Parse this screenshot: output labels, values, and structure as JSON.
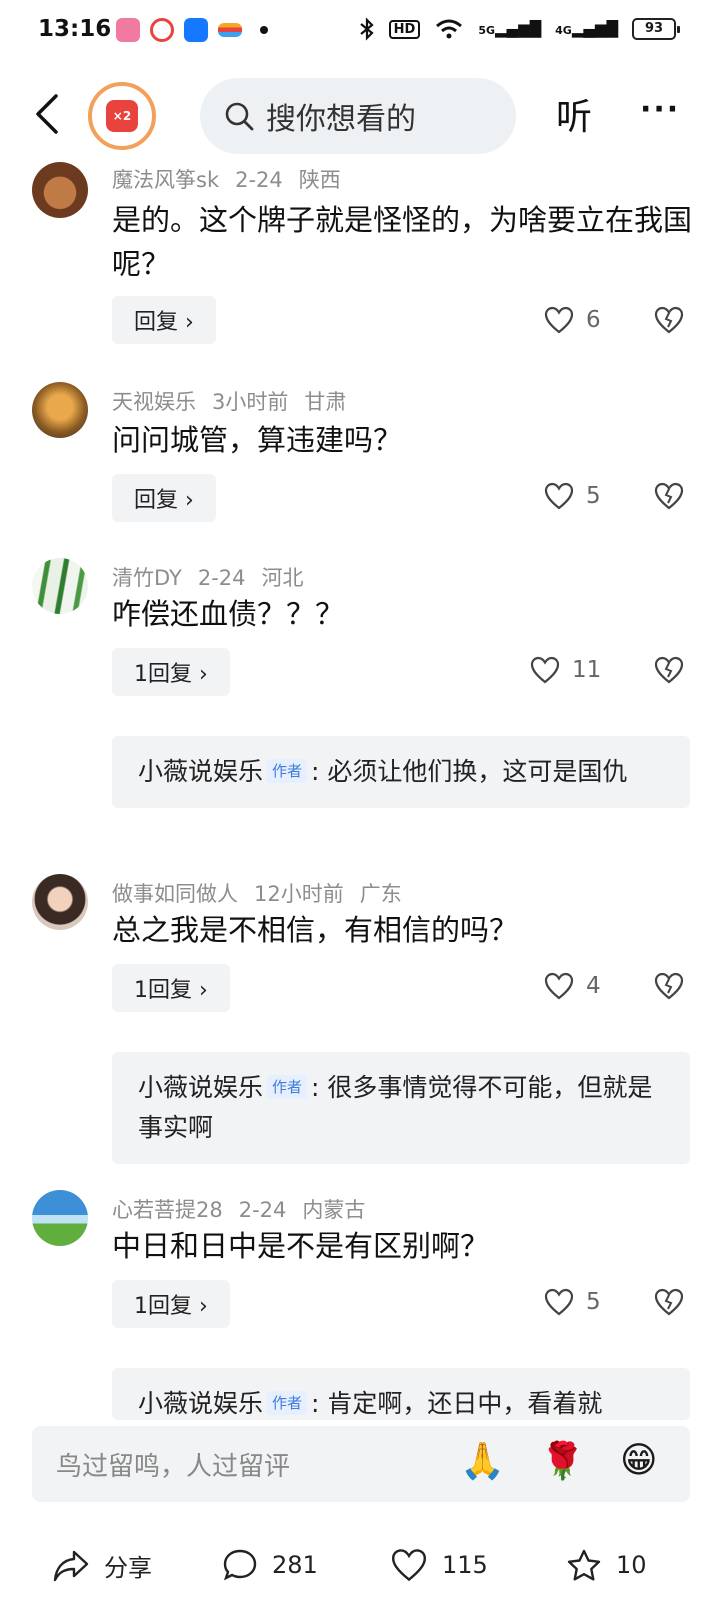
{
  "status_bar": {
    "time": "13:16",
    "signal_5g": "5G",
    "signal_4g": "4G",
    "hd_label": "HD",
    "battery": "93"
  },
  "header": {
    "coin_label": "×2",
    "search_placeholder": "搜你想看的",
    "listen_label": "听",
    "more_label": "···"
  },
  "comments": [
    {
      "user": "魔法风筝sk",
      "time": "2-24",
      "region": "陕西",
      "text": "是的。这个牌子就是怪怪的，为啥要立在我国呢？",
      "reply_label": "回复 ›",
      "likes": "6"
    },
    {
      "user": "天视娱乐",
      "time": "3小时前",
      "region": "甘肃",
      "text": "问问城管，算违建吗？",
      "reply_label": "回复 ›",
      "likes": "5"
    },
    {
      "user": "清竹DY",
      "time": "2-24",
      "region": "河北",
      "text": "咋偿还血债？？？",
      "reply_label": "1回复 ›",
      "likes": "11",
      "sub_reply": {
        "user": "小薇说娱乐",
        "tag": "作者",
        "text": ": 必须让他们换，这可是国仇"
      }
    },
    {
      "user": "做事如同做人",
      "time": "12小时前",
      "region": "广东",
      "text": "总之我是不相信，有相信的吗？",
      "reply_label": "1回复 ›",
      "likes": "4",
      "sub_reply": {
        "user": "小薇说娱乐",
        "tag": "作者",
        "text": ": 很多事情觉得不可能，但就是事实啊"
      }
    },
    {
      "user": "心若菩提28",
      "time": "2-24",
      "region": "内蒙古",
      "text": "中日和日中是不是有区别啊？",
      "reply_label": "1回复 ›",
      "likes": "5",
      "sub_reply": {
        "user": "小薇说娱乐",
        "tag": "作者",
        "text": ": 肯定啊，还日中，看着就"
      }
    }
  ],
  "input_bar": {
    "placeholder": "鸟过留鸣，人过留评",
    "emojis": [
      "🙏",
      "🌹",
      "😁"
    ]
  },
  "bottom_bar": {
    "share_label": "分享",
    "comment_count": "281",
    "like_count": "115",
    "favorite_count": "10"
  }
}
